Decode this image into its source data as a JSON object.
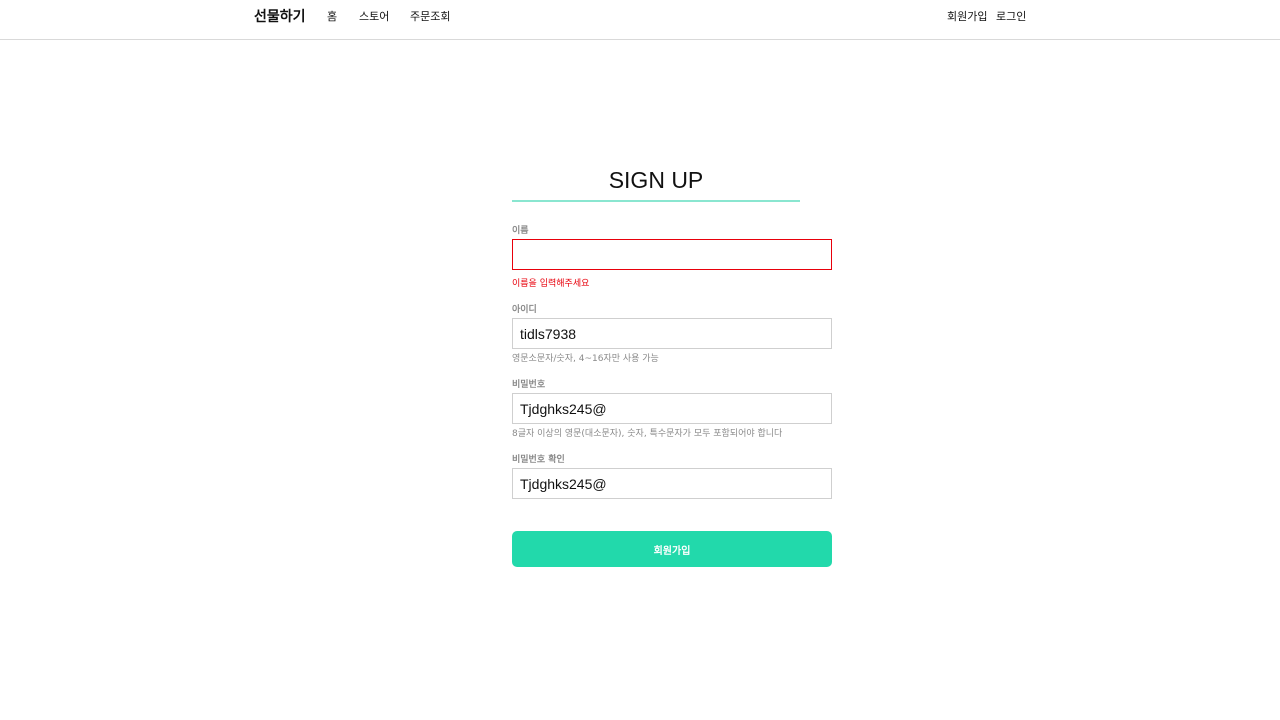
{
  "header": {
    "brand": "선물하기",
    "nav": [
      "홈",
      "스토어",
      "주문조회"
    ],
    "auth": {
      "signup": "회원가입",
      "login": "로그인"
    }
  },
  "form": {
    "title": "SIGN UP",
    "fields": [
      {
        "label": "이름",
        "value": "",
        "error": "이름을 입력해주세요"
      },
      {
        "label": "아이디",
        "value": "tidls7938",
        "hint": "영문소문자/숫자, 4~16자만 사용 가능"
      },
      {
        "label": "비밀번호",
        "value": "Tjdghks245@",
        "hint": "8글자 이상의 영문(대소문자), 숫자, 특수문자가 모두 포함되어야 합니다"
      },
      {
        "label": "비밀번호 확인",
        "value": "Tjdghks245@"
      }
    ],
    "submit_label": "회원가입"
  },
  "colors": {
    "accent": "#22d9ab",
    "title_rule": "#8ae6d0",
    "error": "#e8000b",
    "muted_text": "#8a8a8a",
    "border": "#cfcfcf"
  }
}
